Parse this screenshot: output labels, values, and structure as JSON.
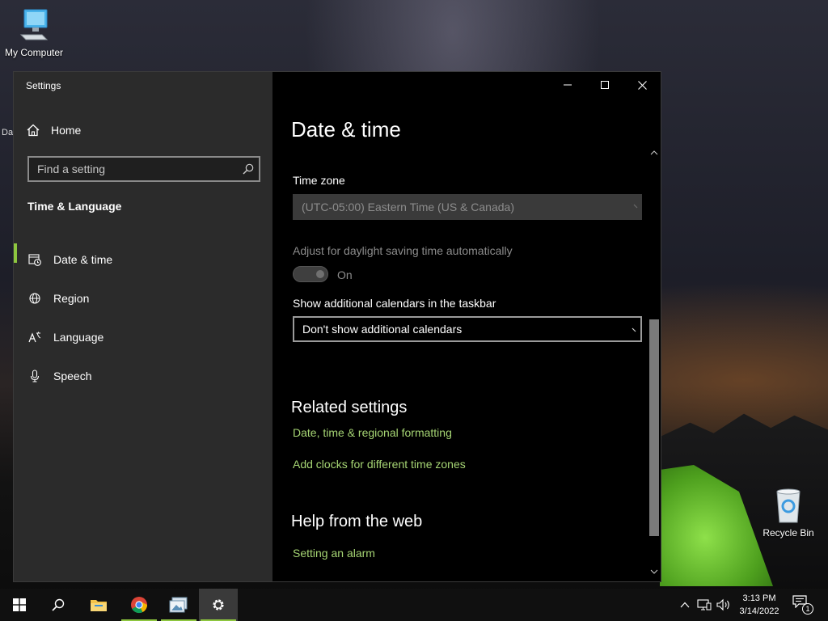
{
  "desktop": {
    "icons": [
      {
        "label": "My Computer"
      },
      {
        "label": "Recycle Bin"
      }
    ],
    "edge_text": "Da"
  },
  "window": {
    "title": "Settings",
    "controls": {
      "minimize": "minimize-icon",
      "maximize": "maximize-icon",
      "close": "close-icon"
    }
  },
  "sidebar": {
    "home_label": "Home",
    "search_placeholder": "Find a setting",
    "section_title": "Time & Language",
    "items": [
      {
        "label": "Date & time",
        "icon": "calendar-clock-icon",
        "active": true
      },
      {
        "label": "Region",
        "icon": "globe-icon",
        "active": false
      },
      {
        "label": "Language",
        "icon": "language-icon",
        "active": false
      },
      {
        "label": "Speech",
        "icon": "microphone-icon",
        "active": false
      }
    ]
  },
  "main": {
    "title": "Date & time",
    "time_zone": {
      "label": "Time zone",
      "value": "(UTC-05:00) Eastern Time (US & Canada)",
      "enabled": false
    },
    "dst": {
      "label": "Adjust for daylight saving time automatically",
      "state": "On",
      "enabled": false
    },
    "calendars": {
      "label": "Show additional calendars in the taskbar",
      "value": "Don't show additional calendars"
    },
    "related": {
      "heading": "Related settings",
      "links": [
        "Date, time & regional formatting",
        "Add clocks for different time zones"
      ]
    },
    "help": {
      "heading": "Help from the web",
      "links": [
        "Setting an alarm"
      ]
    }
  },
  "taskbar": {
    "clock_time": "3:13 PM",
    "clock_date": "3/14/2022",
    "notification_count": "1",
    "accent": "#8dc63f"
  },
  "colors": {
    "accent": "#8dc63f",
    "link": "#a6d574",
    "sidebar_bg": "#2b2b2b",
    "content_bg": "#000000"
  }
}
